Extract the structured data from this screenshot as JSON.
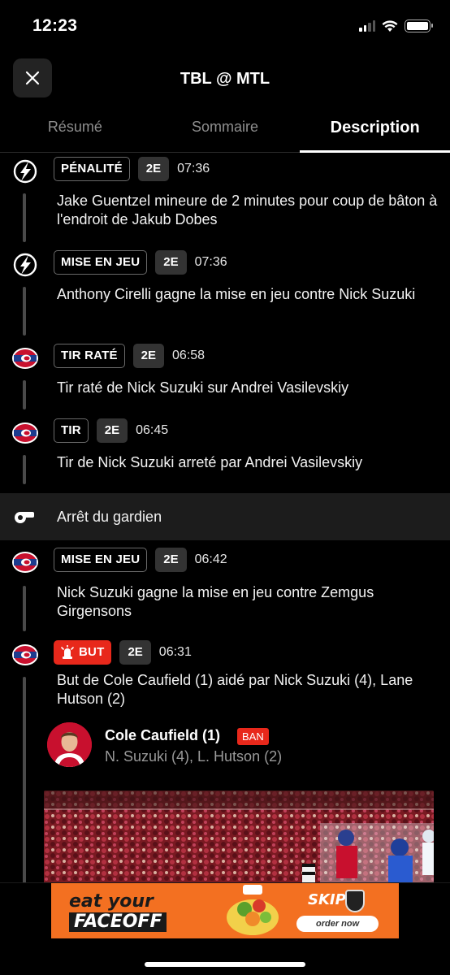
{
  "status_bar": {
    "time": "12:23"
  },
  "header": {
    "title": "TBL @ MTL"
  },
  "tabs": [
    {
      "label": "Résumé",
      "active": false
    },
    {
      "label": "Sommaire",
      "active": false
    },
    {
      "label": "Description",
      "active": true
    }
  ],
  "events": [
    {
      "team": "TBL",
      "tag": "PÉNALITÉ",
      "period": "2E",
      "time": "07:36",
      "text": "Jake Guentzel mineure de 2 minutes pour coup de bâton à l'endroit de Jakub Dobes"
    },
    {
      "team": "TBL",
      "tag": "MISE EN JEU",
      "period": "2E",
      "time": "07:36",
      "text": "Anthony Cirelli gagne la mise en jeu contre Nick Suzuki"
    },
    {
      "team": "MTL",
      "tag": "TIR RATÉ",
      "period": "2E",
      "time": "06:58",
      "text": "Tir raté de Nick Suzuki sur Andrei Vasilevskiy"
    },
    {
      "team": "MTL",
      "tag": "TIR",
      "period": "2E",
      "time": "06:45",
      "text": "Tir de Nick Suzuki arreté par Andrei Vasilevskiy"
    },
    {
      "team": "MTL",
      "tag": "MISE EN JEU",
      "period": "2E",
      "time": "06:42",
      "text": "Nick Suzuki gagne la mise en jeu contre Zemgus Girgensons"
    },
    {
      "team": "MTL",
      "tag": "BUT",
      "period": "2E",
      "time": "06:31",
      "text": "But de Cole Caufield (1) aidé par Nick Suzuki (4), Lane Hutson (2)"
    }
  ],
  "stoppage": {
    "label": "Arrêt du gardien"
  },
  "goal_card": {
    "scorer": "Cole Caufield (1)",
    "badge": "BAN",
    "assists": "N. Suzuki (4), L. Hutson (2)"
  },
  "ad": {
    "headline_1": "eat your",
    "headline_2": "FACEOFF",
    "brand": "SKIP",
    "cta": "order now"
  },
  "colors": {
    "accent_red": "#e8281b",
    "tbl_blue": "#002868",
    "mtl_red": "#c8102e",
    "ad_orange": "#f37021"
  }
}
